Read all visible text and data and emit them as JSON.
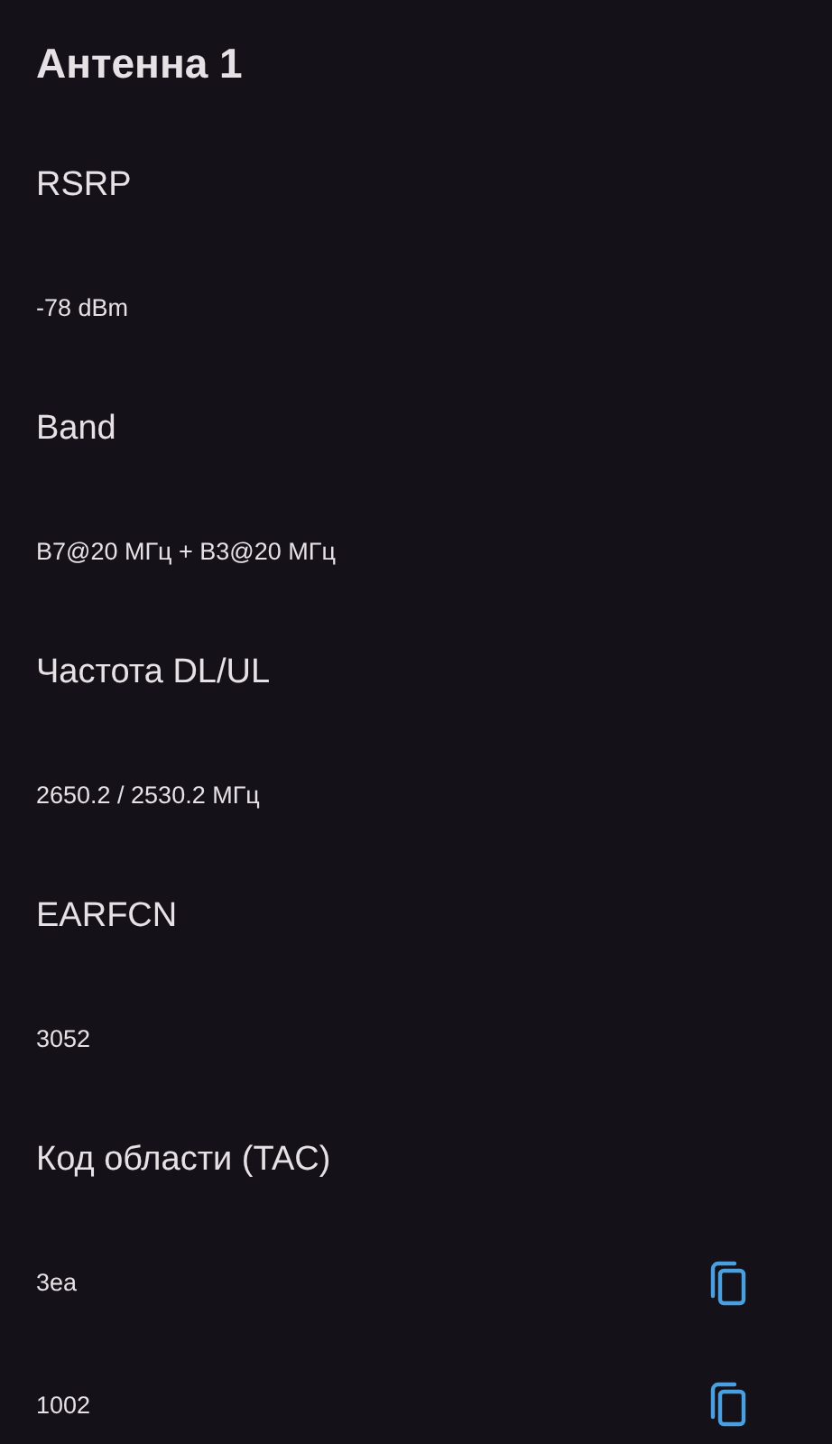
{
  "title": "Антенна 1",
  "fields": [
    {
      "label": "RSRP",
      "value": "-78 dBm",
      "copyable": false
    },
    {
      "label": "Band",
      "value": "B7@20 МГц + B3@20 МГц",
      "copyable": false
    },
    {
      "label": "Частота DL/UL",
      "value": "2650.2 / 2530.2 МГц",
      "copyable": false
    },
    {
      "label": "EARFCN",
      "value": "3052",
      "copyable": false
    },
    {
      "label": "Код области (TAC)",
      "value": "3ea",
      "copyable": true
    },
    {
      "value": "1002",
      "copyable": true
    }
  ]
}
